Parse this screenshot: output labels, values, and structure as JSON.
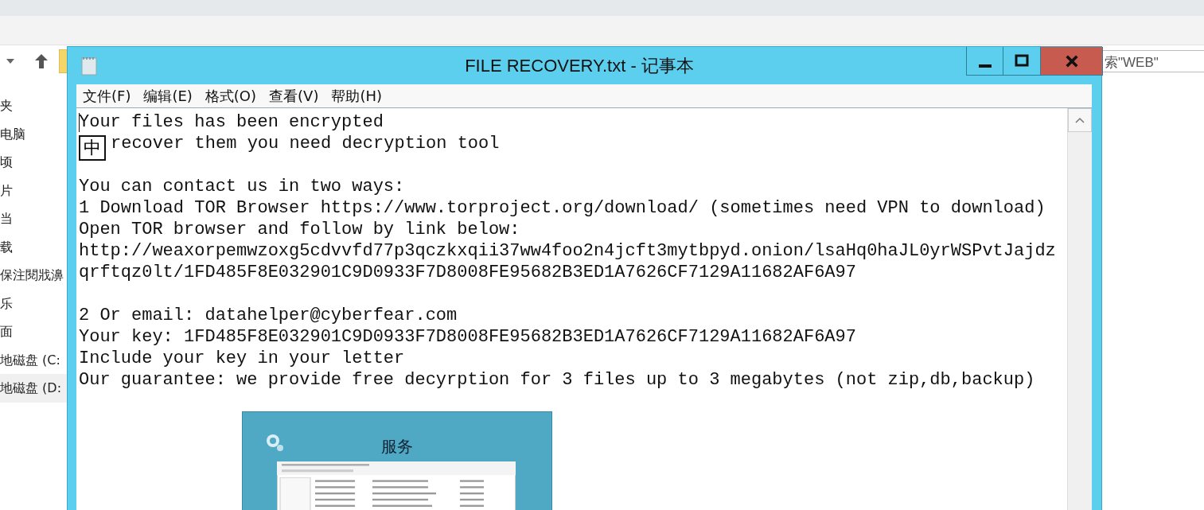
{
  "explorer": {
    "search": {
      "value": "索\"WEB\""
    },
    "sidebar": {
      "items": [
        {
          "label": "夹",
          "selected": false
        },
        {
          "label": "电脑",
          "selected": false
        },
        {
          "label": "顷",
          "selected": false
        },
        {
          "label": "片",
          "selected": false
        },
        {
          "label": "当",
          "selected": false
        },
        {
          "label": "载",
          "selected": false
        },
        {
          "label": "保注閱戕濞",
          "selected": false
        },
        {
          "label": "乐",
          "selected": false
        },
        {
          "label": "面",
          "selected": false
        },
        {
          "label": "地磁盘 (C:",
          "selected": false
        },
        {
          "label": "地磁盘 (D:",
          "selected": true
        }
      ]
    }
  },
  "notepad": {
    "title": "FILE RECOVERY.txt - 记事本",
    "menu": [
      "文件(F)",
      "编辑(E)",
      "格式(O)",
      "查看(V)",
      "帮助(H)"
    ],
    "ime_indicator": "中",
    "paragraphs": [
      [
        "Your files has been encrypted",
        "recover them you need decryption tool"
      ],
      [
        "You can contact us in two ways:",
        "1 Download TOR Browser https://www.torproject.org/download/ (sometimes need VPN to download)",
        "Open TOR browser and follow by link below:",
        "http://weaxorpemwzoxg5cdvvfd77p3qczkxqii37ww4foo2n4jcft3mytbpyd.onion/lsaHq0haJL0yrWSPvtJajdz",
        "qrftqz0lt/1FD485F8E032901C9D0933F7D8008FE95682B3ED1A7626CF7129A11682AF6A97"
      ],
      [
        "2 Or email: datahelper@cyberfear.com",
        "Your key: 1FD485F8E032901C9D0933F7D8008FE95682B3ED1A7626CF7129A11682AF6A97",
        "Include your key in your letter",
        "Our guarantee: we provide free decyrption for 3 files up to 3 megabytes (not zip,db,backup)"
      ]
    ],
    "embedded_slide": {
      "title": "服务"
    }
  }
}
